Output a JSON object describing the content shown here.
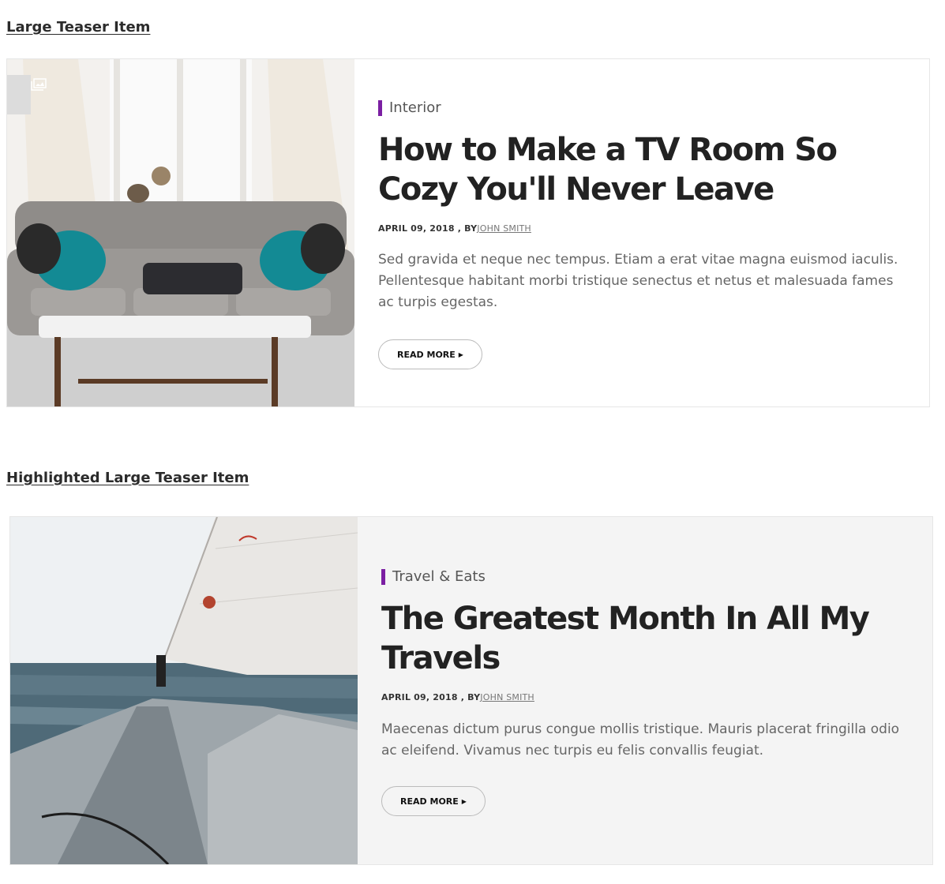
{
  "sections": [
    {
      "heading": "Large Teaser Item",
      "category": "Interior",
      "title": "How to Make a TV Room So Cozy You'll Never Leave",
      "date": "APRIL 09, 2018 , BY",
      "author": "JOHN SMITH",
      "excerpt": "Sed gravida et neque nec tempus. Etiam a erat vitae magna euismod iaculis. Pellentesque habitant morbi tristique senectus et netus et malesuada fames ac turpis egestas.",
      "read_more": "READ MORE",
      "image_icon": "gallery-icon"
    },
    {
      "heading": "Highlighted Large Teaser Item",
      "category": "Travel & Eats",
      "title": "The Greatest Month In All My Travels",
      "date": "APRIL 09, 2018 , BY",
      "author": "JOHN SMITH",
      "excerpt": "Maecenas dictum purus congue mollis tristique. Mauris placerat fringilla odio ac eleifend. Vivamus nec turpis eu felis convallis feugiat.",
      "read_more": "READ MORE"
    }
  ],
  "colors": {
    "accent": "#7b1fa2",
    "highlight_bg": "#f4f4f4",
    "border": "#e6e6e6"
  }
}
